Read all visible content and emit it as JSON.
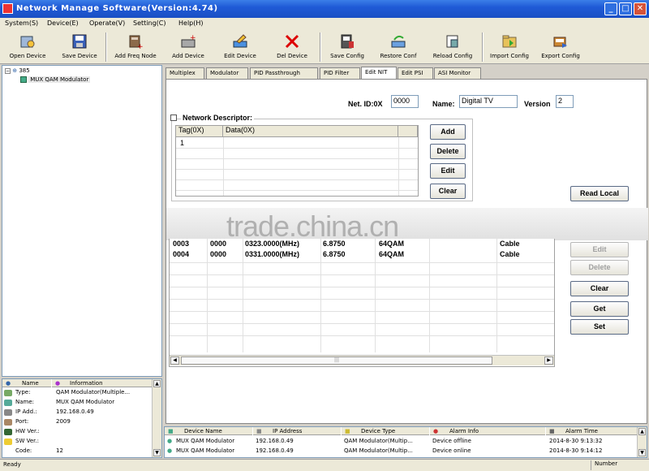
{
  "window": {
    "title": "Network Manage Software(Version:4.74)"
  },
  "menu": [
    "System(S)",
    "Device(E)",
    "Operate(V)",
    "Setting(C)",
    "Help(H)"
  ],
  "toolbar": [
    {
      "label": "Open Device",
      "icon": "open-device-icon"
    },
    {
      "label": "Save Device",
      "icon": "save-device-icon"
    },
    {
      "label": "Add Freq Node",
      "icon": "add-freq-node-icon"
    },
    {
      "label": "Add Device",
      "icon": "add-device-icon"
    },
    {
      "label": "Edit Device",
      "icon": "edit-device-icon"
    },
    {
      "label": "Del Device",
      "icon": "del-device-icon"
    },
    {
      "label": "Save Config",
      "icon": "save-config-icon"
    },
    {
      "label": "Restore Conf",
      "icon": "restore-conf-icon"
    },
    {
      "label": "Reload Config",
      "icon": "reload-config-icon"
    },
    {
      "label": "Import Config",
      "icon": "import-config-icon"
    },
    {
      "label": "Export Config",
      "icon": "export-config-icon"
    }
  ],
  "tree": {
    "root": "385",
    "child": "MUX QAM Modulator"
  },
  "info": {
    "headers": [
      "Name",
      "Information"
    ],
    "rows": [
      {
        "key": "Type:",
        "value": "QAM Modulator(Multiple..."
      },
      {
        "key": "Name:",
        "value": "MUX QAM Modulator"
      },
      {
        "key": "IP Add.:",
        "value": "192.168.0.49"
      },
      {
        "key": "Port:",
        "value": "2009"
      },
      {
        "key": "HW Ver.:",
        "value": ""
      },
      {
        "key": "SW Ver.:",
        "value": ""
      },
      {
        "key": "Code:",
        "value": "12"
      }
    ]
  },
  "tabs": [
    "Multiplex",
    "Modulator",
    "PID Passthrough",
    "PID Filter",
    "Edit NIT",
    "Edit PSI",
    "ASI Monitor"
  ],
  "nit": {
    "net_id_label": "Net. ID:0X",
    "net_id_value": "0000",
    "name_label": "Name:",
    "name_value": "Digital TV",
    "version_label": "Version",
    "version_value": "2",
    "network_descriptor_label": "Network Descriptor:",
    "desc_headers": [
      "Tag(0X)",
      "Data(0X)"
    ],
    "desc_rows": [
      [
        "1",
        ""
      ]
    ],
    "buttons": {
      "add": "Add",
      "delete": "Delete",
      "edit": "Edit",
      "clear": "Clear"
    }
  },
  "transport_rows": [
    [
      "0003",
      "0000",
      "0323.0000(MHz)",
      "6.8750",
      "64QAM",
      "Cable"
    ],
    [
      "0004",
      "0000",
      "0331.0000(MHz)",
      "6.8750",
      "64QAM",
      "Cable"
    ]
  ],
  "right_buttons": {
    "read_local": "Read Local",
    "edit": "Edit",
    "delete": "Delete",
    "clear": "Clear",
    "get": "Get",
    "set": "Set"
  },
  "watermark": "trade.china.cn",
  "log": {
    "headers": [
      "Device Name",
      "IP Address",
      "Device Type",
      "Alarm Info",
      "Alarm Time"
    ],
    "rows": [
      [
        "MUX QAM Modulator",
        "192.168.0.49",
        "QAM Modulator(Multip...",
        "Device offline",
        "2014-8-30 9:13:32"
      ],
      [
        "MUX QAM Modulator",
        "192.168.0.49",
        "QAM Modulator(Multip...",
        "Device online",
        "2014-8-30 9:14:12"
      ]
    ]
  },
  "status": {
    "left": "Ready",
    "right": "Number"
  }
}
